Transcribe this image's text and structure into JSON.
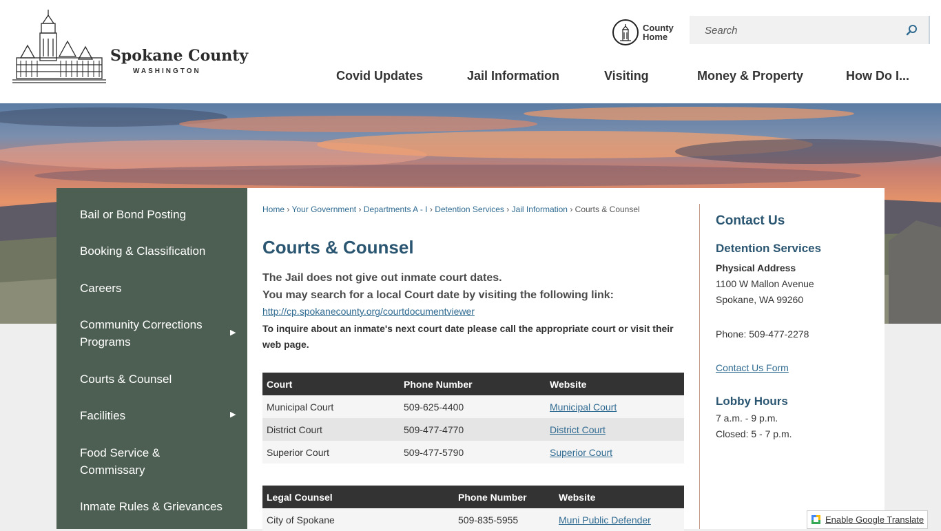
{
  "header": {
    "logo_title": "Spokane County",
    "logo_subtitle": "WASHINGTON",
    "county_home_label": "County Home",
    "search_placeholder": "Search"
  },
  "nav": {
    "items": [
      "Covid Updates",
      "Jail Information",
      "Visiting",
      "Money & Property",
      "How Do I..."
    ]
  },
  "sidebar": {
    "items": [
      {
        "label": "Bail or Bond Posting"
      },
      {
        "label": "Booking & Classification"
      },
      {
        "label": "Careers"
      },
      {
        "label": "Community Corrections Programs",
        "arrow": "▶"
      },
      {
        "label": "Courts & Counsel"
      },
      {
        "label": "Facilities",
        "arrow": "▶"
      },
      {
        "label": "Food Service & Commissary"
      },
      {
        "label": "Inmate Rules & Grievances"
      }
    ]
  },
  "breadcrumb": {
    "items": [
      "Home",
      "Your Government",
      "Departments A - I",
      "Detention Services",
      "Jail Information"
    ],
    "current": "Courts & Counsel",
    "separator": "›"
  },
  "main": {
    "title": "Courts & Counsel",
    "intro_line1": "The Jail does not give out inmate court dates.",
    "intro_line2": "You may search for a local Court date by visiting the following link:",
    "intro_link": "http://cp.spokanecounty.org/courtdocumentviewer",
    "intro_line3": "To inquire about an inmate's next court date please call the appropriate court or visit their web page."
  },
  "courts_table": {
    "headers": [
      "Court",
      "Phone Number",
      "Website"
    ],
    "rows": [
      [
        "Municipal Court",
        "509-625-4400",
        "Municipal Court"
      ],
      [
        "District Court",
        "509-477-4770",
        "District Court"
      ],
      [
        "Superior Court",
        "509-477-5790",
        "Superior Court"
      ]
    ]
  },
  "counsel_table": {
    "headers": [
      "Legal Counsel",
      "Phone Number",
      "Website"
    ],
    "rows": [
      [
        "City of Spokane",
        "509-835-5955",
        "Muni Public Defender"
      ]
    ]
  },
  "contact": {
    "heading": "Contact Us",
    "department": "Detention Services",
    "address_label": "Physical Address",
    "address_line1": "1100 W Mallon Avenue",
    "address_line2": "Spokane, WA 99260",
    "phone": "Phone: 509-477-2278",
    "form_link": "Contact Us Form",
    "hours_heading": "Lobby Hours",
    "hours_line1": "7 a.m. - 9 p.m.",
    "hours_line2": "Closed: 5 - 7 p.m."
  },
  "translate": {
    "label": "Enable Google Translate"
  },
  "colors": {
    "sidebar_bg": "#4d5f52",
    "heading_blue": "#2b5672",
    "link_blue": "#2f6a91",
    "table_header": "#333333"
  }
}
